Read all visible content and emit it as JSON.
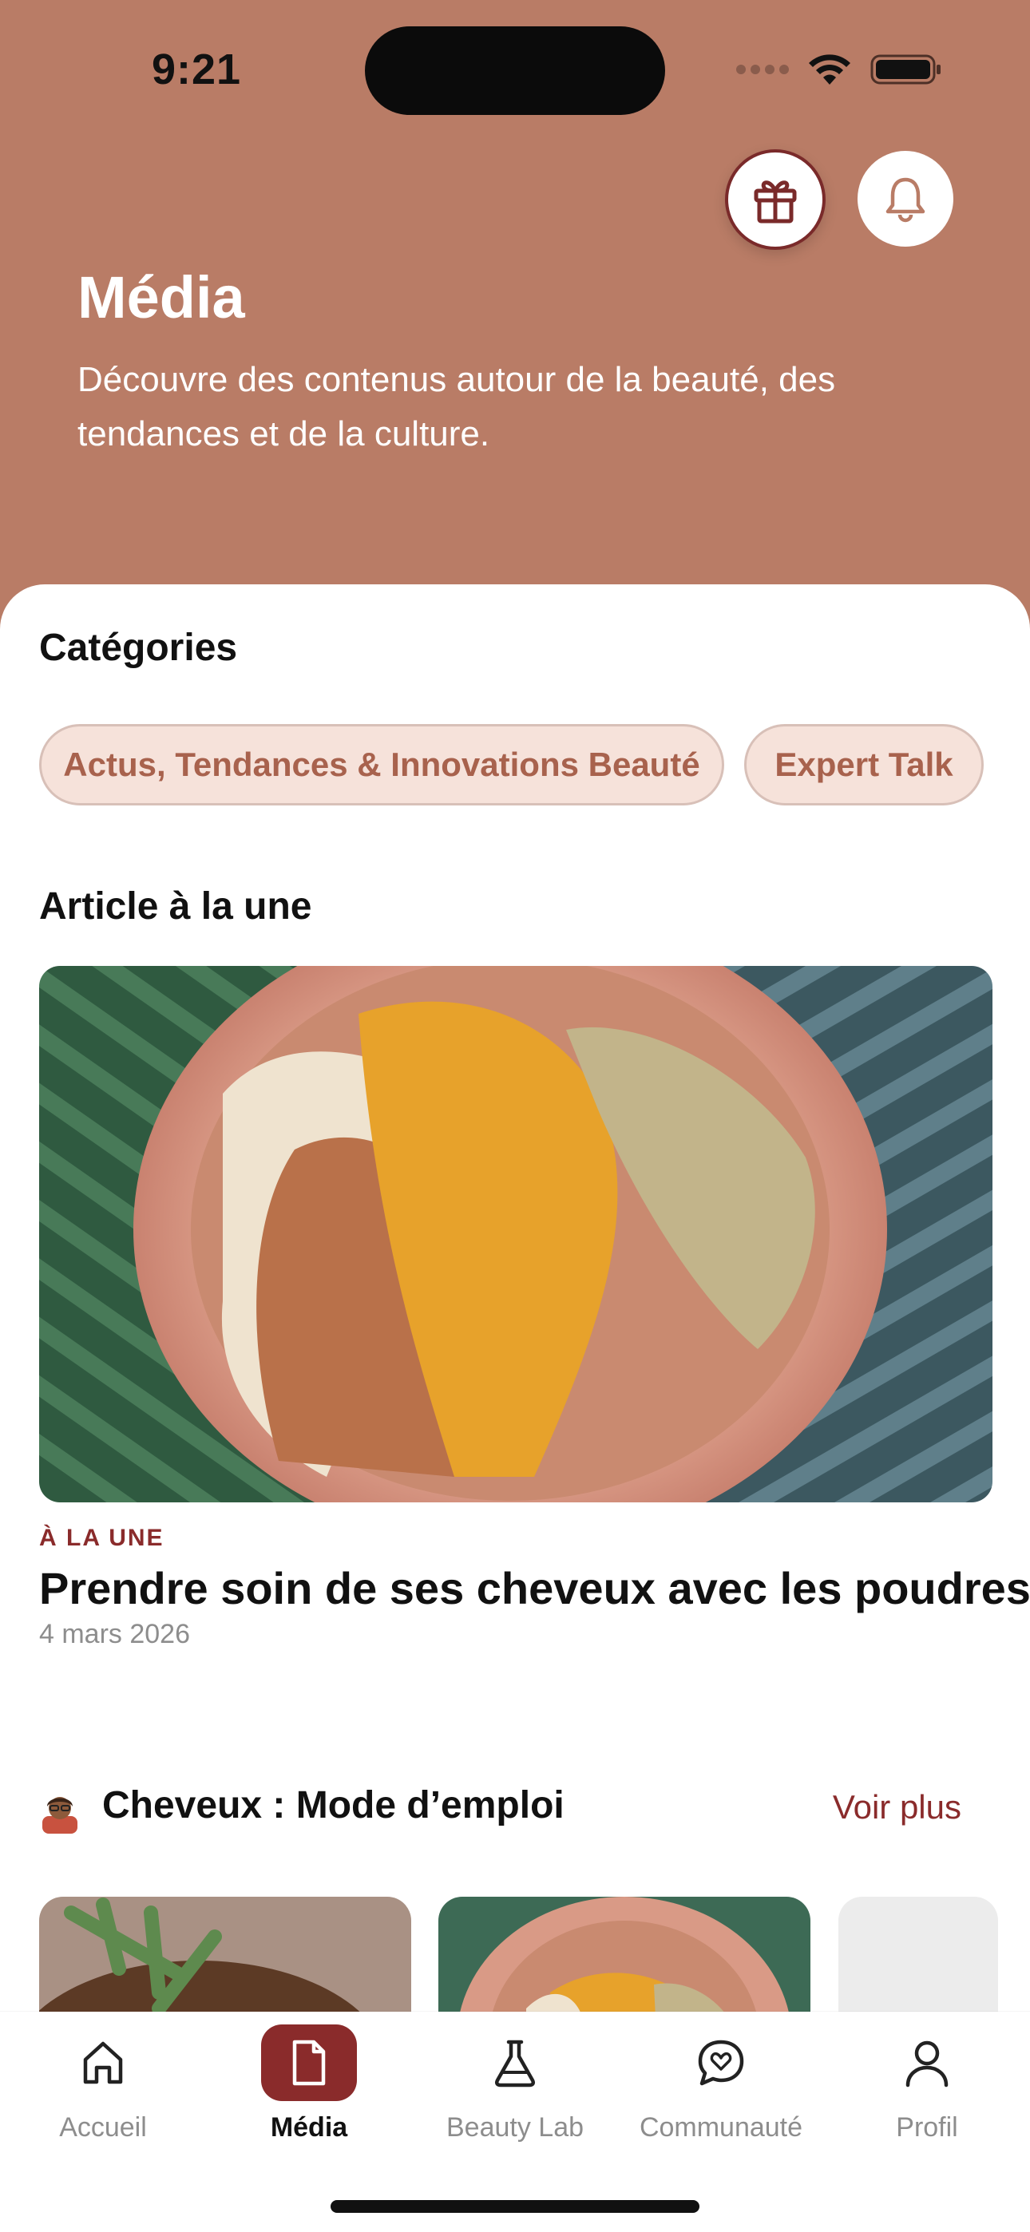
{
  "status_bar": {
    "time": "9:21"
  },
  "header": {
    "title": "Média",
    "subtitle": "Découvre des contenus autour de la beauté, des tendances et de la culture."
  },
  "categories": {
    "title": "Catégories",
    "chips": [
      "Actus, Tendances & Innovations Beauté",
      "Expert Talk"
    ]
  },
  "featured": {
    "section_title": "Article à la une",
    "label": "À LA UNE",
    "headline": "Prendre soin de ses cheveux avec les poudres",
    "date": "4 mars 2026"
  },
  "row": {
    "title": "Cheveux : Mode d’emploi",
    "see_more": "Voir plus"
  },
  "tabs": [
    {
      "label": "Accueil",
      "icon": "home-icon"
    },
    {
      "label": "Média",
      "icon": "document-icon",
      "active": true
    },
    {
      "label": "Beauty Lab",
      "icon": "flask-icon"
    },
    {
      "label": "Communauté",
      "icon": "chat-heart-icon"
    },
    {
      "label": "Profil",
      "icon": "person-icon"
    }
  ],
  "colors": {
    "header_bg": "#b97c66",
    "accent": "#8a2b2b",
    "chip_bg": "#f6e2da",
    "chip_text": "#a8624d"
  }
}
